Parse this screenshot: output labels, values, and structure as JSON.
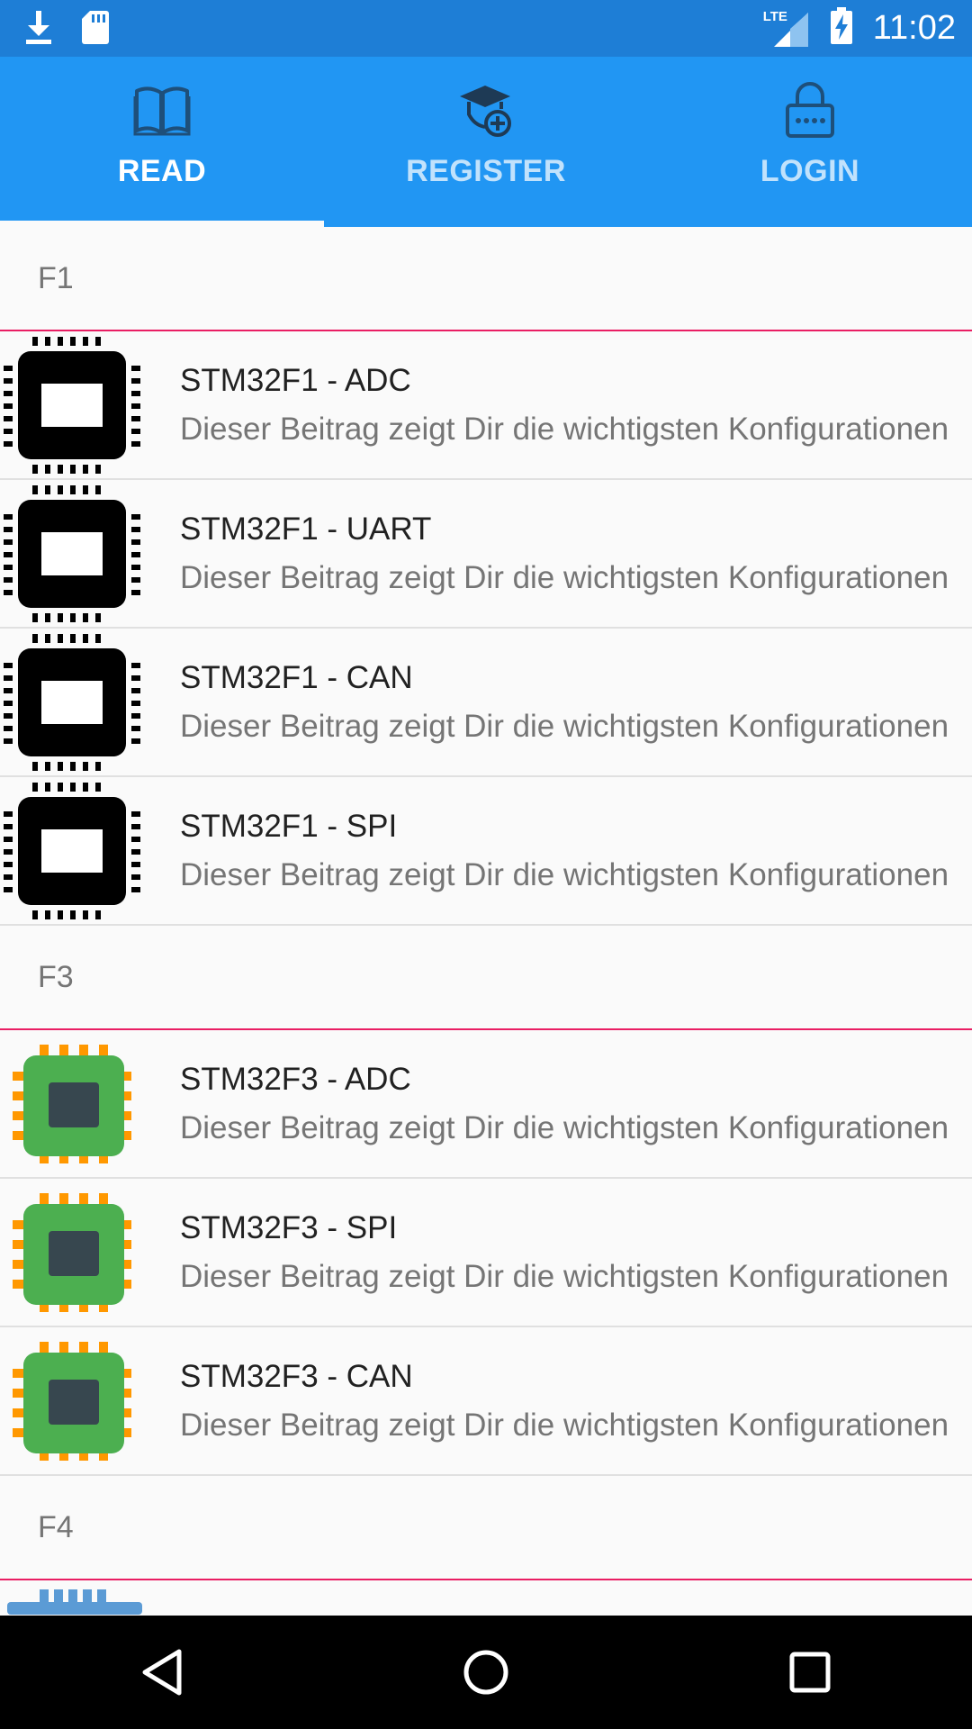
{
  "status_bar": {
    "time": "11:02",
    "network_label": "LTE",
    "icons": [
      "download-icon",
      "sd-card-icon",
      "signal-icon",
      "battery-charging-icon"
    ]
  },
  "tabs": [
    {
      "label": "READ",
      "icon": "book-icon",
      "active": true
    },
    {
      "label": "REGISTER",
      "icon": "graduation-cap-add-icon",
      "active": false
    },
    {
      "label": "LOGIN",
      "icon": "lock-icon",
      "active": false
    }
  ],
  "sections": [
    {
      "header": "F1",
      "items": [
        {
          "title": "STM32F1 - ADC",
          "subtitle": "Dieser Beitrag zeigt Dir die wichtigsten Konfigurationen",
          "icon": "chip-black-icon"
        },
        {
          "title": "STM32F1 - UART",
          "subtitle": "Dieser Beitrag zeigt Dir die wichtigsten Konfigurationen",
          "icon": "chip-black-icon"
        },
        {
          "title": "STM32F1 - CAN",
          "subtitle": "Dieser Beitrag zeigt Dir die wichtigsten Konfigurationen",
          "icon": "chip-black-icon"
        },
        {
          "title": "STM32F1 - SPI",
          "subtitle": "Dieser Beitrag zeigt Dir die wichtigsten Konfigurationen",
          "icon": "chip-black-icon"
        }
      ]
    },
    {
      "header": "F3",
      "items": [
        {
          "title": "STM32F3 - ADC",
          "subtitle": "Dieser Beitrag zeigt Dir die wichtigsten Konfigurationen",
          "icon": "chip-green-icon"
        },
        {
          "title": "STM32F3 - SPI",
          "subtitle": "Dieser Beitrag zeigt Dir die wichtigsten Konfigurationen",
          "icon": "chip-green-icon"
        },
        {
          "title": "STM32F3 - CAN",
          "subtitle": "Dieser Beitrag zeigt Dir die wichtigsten Konfigurationen",
          "icon": "chip-green-icon"
        }
      ]
    },
    {
      "header": "F4",
      "items": []
    }
  ],
  "nav_bar": [
    "back-icon",
    "home-icon",
    "recents-icon"
  ],
  "colors": {
    "status_bar": "#1E7ED6",
    "app_bar": "#2196F3",
    "section_divider": "#E91E63",
    "chip_green": "#4CAF50",
    "chip_pins": "#FF9800"
  }
}
